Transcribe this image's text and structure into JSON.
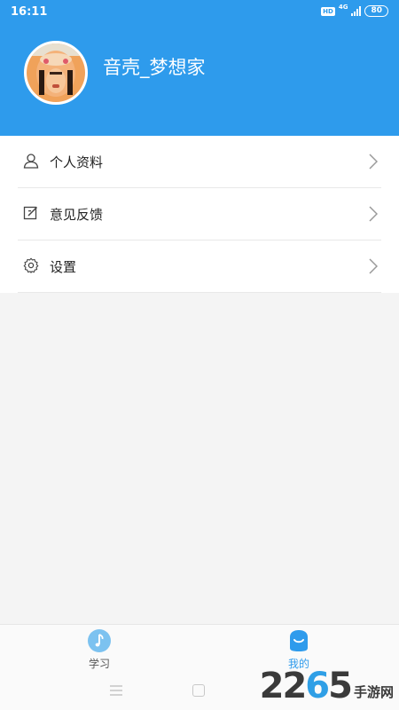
{
  "status_bar": {
    "time": "16:11",
    "hd": "HD",
    "network": "4G",
    "battery": "80"
  },
  "profile": {
    "username": "音壳_梦想家"
  },
  "menu": {
    "items": [
      {
        "label": "个人资料",
        "icon": "user-icon"
      },
      {
        "label": "意见反馈",
        "icon": "feedback-edit-icon"
      },
      {
        "label": "设置",
        "icon": "gear-icon"
      }
    ]
  },
  "tabbar": {
    "tabs": [
      {
        "label": "学习",
        "icon": "music-note-icon",
        "active": false
      },
      {
        "label": "我的",
        "icon": "profile-face-icon",
        "active": true
      }
    ]
  },
  "watermark": {
    "number": "2265",
    "text": "手游网"
  },
  "colors": {
    "primary": "#2e9bec",
    "background": "#f4f4f4"
  }
}
